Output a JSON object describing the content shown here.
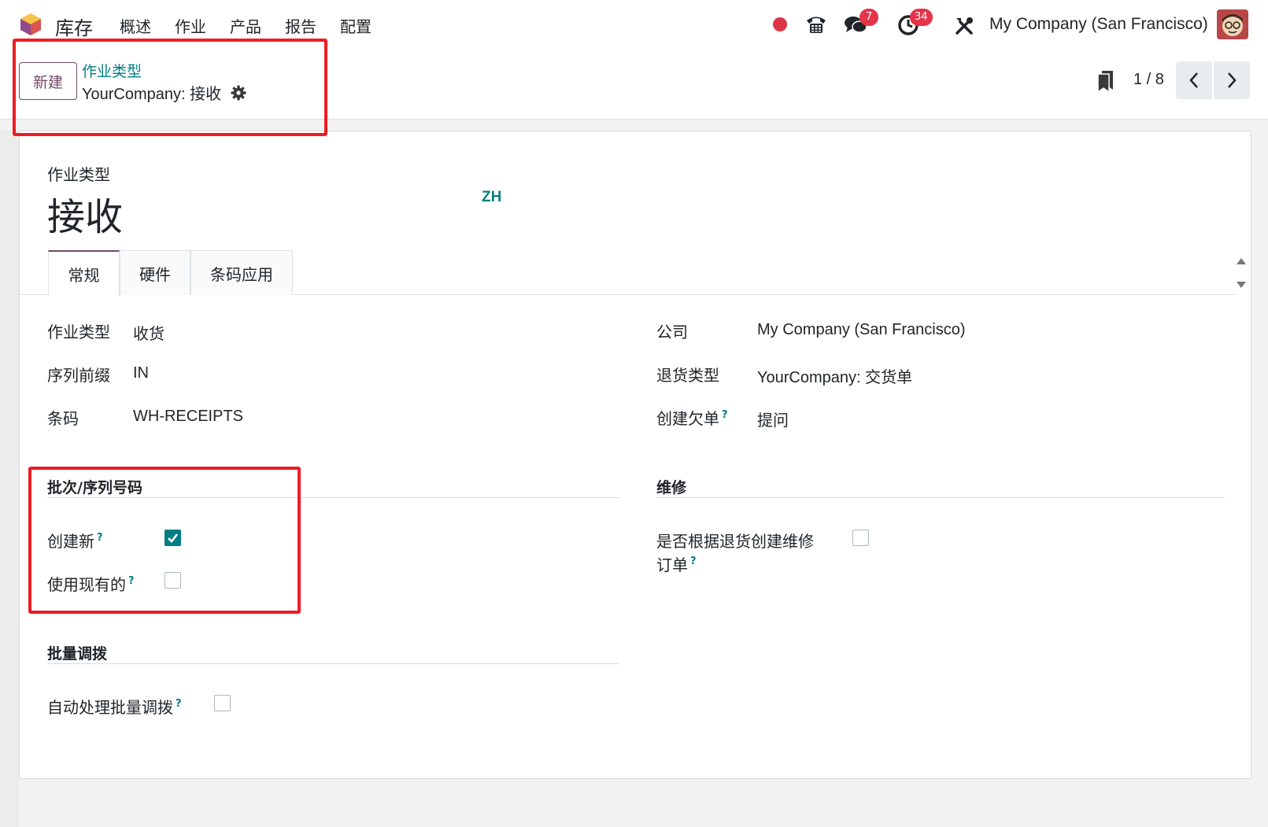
{
  "navbar": {
    "app_name": "库存",
    "menu": [
      "概述",
      "作业",
      "产品",
      "报告",
      "配置"
    ],
    "messages_badge": "7",
    "activities_badge": "34",
    "company": "My Company (San Francisco)"
  },
  "control_panel": {
    "new_button": "新建",
    "breadcrumb": "作业类型",
    "record_title": "YourCompany: 接收",
    "pager": "1 / 8"
  },
  "form": {
    "type_label": "作业类型",
    "type_name": "接收",
    "lang": "ZH",
    "tabs": [
      "常规",
      "硬件",
      "条码应用"
    ],
    "left_fields": [
      {
        "label": "作业类型",
        "value": "收货"
      },
      {
        "label": "序列前缀",
        "value": "IN"
      },
      {
        "label": "条码",
        "value": "WH-RECEIPTS"
      }
    ],
    "right_fields": [
      {
        "label": "公司",
        "value": "My Company (San Francisco)"
      },
      {
        "label": "退货类型",
        "value": "YourCompany: 交货单"
      },
      {
        "label": "创建欠单",
        "value": "提问"
      }
    ],
    "lots_section": {
      "title": "批次/序列号码",
      "create_new_label": "创建新",
      "create_new_checked": true,
      "use_existing_label": "使用现有的",
      "use_existing_checked": false
    },
    "repair_section": {
      "title": "维修",
      "label_line1": "是否根据退货创建维修",
      "label_line2": "订单",
      "checked": false
    },
    "batch_section": {
      "title": "批量调拨",
      "auto_label": "自动处理批量调拨",
      "checked": false
    },
    "help_mark": "?"
  },
  "colors": {
    "brand": "#714b67",
    "accent": "#017e84",
    "badge": "#e4344a",
    "annotation": "#ee1c24"
  }
}
